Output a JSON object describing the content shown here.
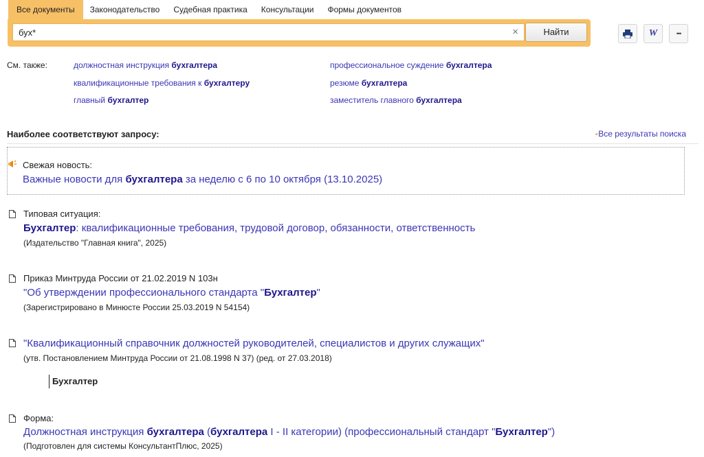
{
  "tabs": [
    "Все документы",
    "Законодательство",
    "Судебная практика",
    "Консультации",
    "Формы документов"
  ],
  "search": {
    "value": "бух*",
    "clear": "×",
    "button": "Найти"
  },
  "toolbar": {
    "word": "W",
    "more": "•••"
  },
  "see_also": {
    "label": "См. также:",
    "items": [
      {
        "pre": "должностная инструкция ",
        "hl": "бухгалтера",
        "post": ""
      },
      {
        "pre": "квалификационные требования к ",
        "hl": "бухгалтеру",
        "post": ""
      },
      {
        "pre": "главный ",
        "hl": "бухгалтер",
        "post": ""
      },
      {
        "pre": "профессиональное суждение ",
        "hl": "бухгалтера",
        "post": ""
      },
      {
        "pre": "резюме ",
        "hl": "бухгалтера",
        "post": ""
      },
      {
        "pre": "заместитель главного ",
        "hl": "бухгалтера",
        "post": ""
      }
    ]
  },
  "results_header": "Наиболее соответствуют запросу:",
  "all_results": "Все результаты поиска",
  "news": {
    "label": "Свежая новость:",
    "t1": "Важные новости для ",
    "t2": "бухгалтера",
    "t3": " за неделю с 6 по 10 октября (13.10.2025)"
  },
  "results": [
    {
      "label": "Типовая ситуация:",
      "t1": "",
      "t2": "Бухгалтер",
      "t3": ": квалификационные требования, трудовой договор, обязанности, ответственность",
      "sub": "(Издательство \"Главная книга\", 2025)"
    },
    {
      "label": "Приказ Минтруда России от 21.02.2019 N 103н",
      "t1": "\"Об утверждении профессионального стандарта \"",
      "t2": "Бухгалтер",
      "t3": "\"",
      "sub": "(Зарегистрировано в Минюсте России 25.03.2019 N 54154)"
    },
    {
      "label": "",
      "t1": "\"Квалификационный справочник должностей руководителей, специалистов и других служащих\"",
      "t2": "",
      "t3": "",
      "sub": "(утв. Постановлением Минтруда России от 21.08.1998 N 37) (ред. от 27.03.2018)",
      "section": "Бухгалтер"
    },
    {
      "label": "Форма:",
      "t1": "Должностная инструкция ",
      "t2": "бухгалтера",
      "t3": " (",
      "t4": "бухгалтера",
      "t5": " I - II категории) (профессиональный стандарт \"",
      "t6": "Бухгалтер",
      "t7": "\")",
      "sub": "(Подготовлен для системы КонсультантПлюс, 2025)"
    }
  ]
}
